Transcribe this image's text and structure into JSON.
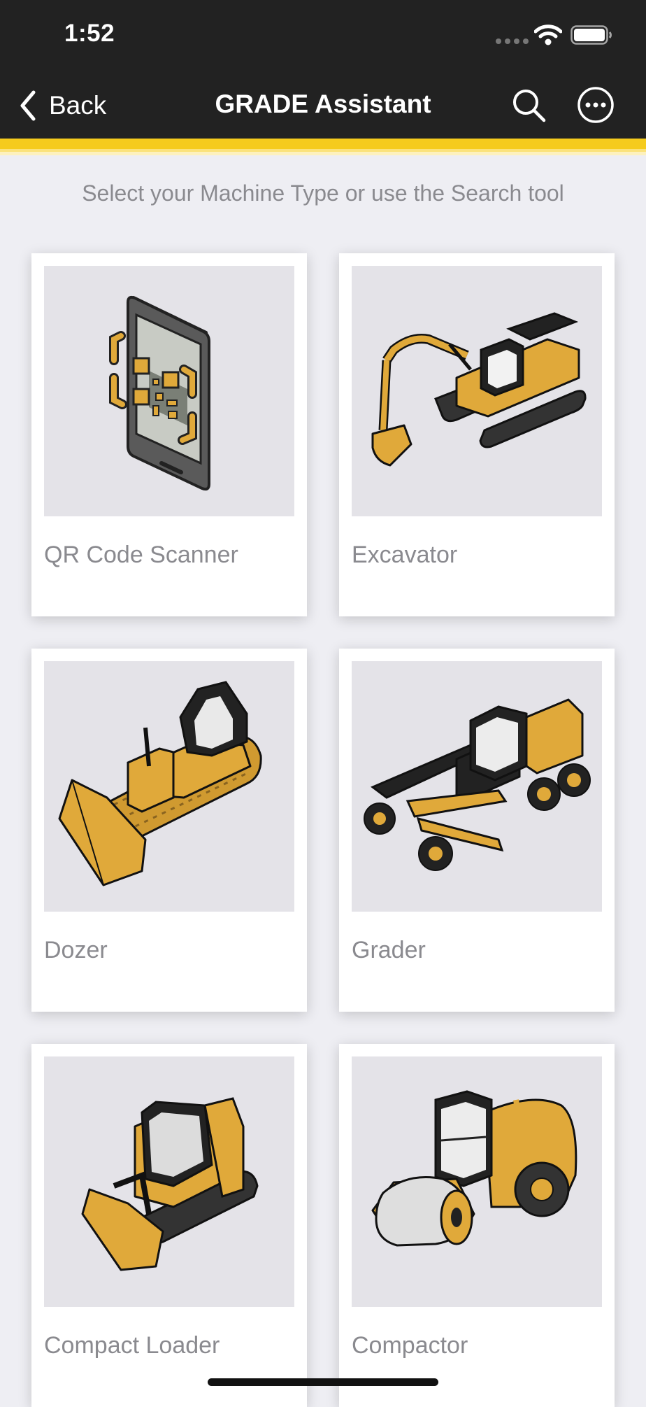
{
  "status_bar": {
    "time": "1:52"
  },
  "nav": {
    "back_label": "Back",
    "title": "GRADE Assistant"
  },
  "instruction": "Select your Machine Type or use the Search tool",
  "machines": [
    {
      "label": "QR Code Scanner",
      "icon": "qr-scanner-icon"
    },
    {
      "label": "Excavator",
      "icon": "excavator-icon"
    },
    {
      "label": "Dozer",
      "icon": "dozer-icon"
    },
    {
      "label": "Grader",
      "icon": "grader-icon"
    },
    {
      "label": "Compact Loader",
      "icon": "compact-loader-icon"
    },
    {
      "label": "Compactor",
      "icon": "compactor-icon"
    }
  ],
  "colors": {
    "bar": "#222222",
    "accent": "#f5cb1d",
    "machine_yellow": "#e0a93a",
    "card_image_bg": "#e4e3e8",
    "label_gray": "#8a8a8f"
  }
}
